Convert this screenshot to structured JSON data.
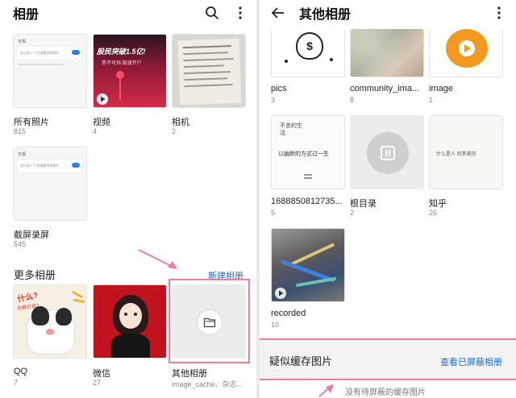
{
  "left": {
    "title": "相册",
    "albums": [
      {
        "name": "所有照片",
        "count": "815"
      },
      {
        "name": "视频",
        "count": "4"
      },
      {
        "name": "相机",
        "count": "2"
      },
      {
        "name": "截屏录屏",
        "count": "545"
      }
    ],
    "video_banner_top": "股民突破1.5亿!",
    "video_banner_bottom": "势不可挡 极速开户",
    "more_section": "更多相册",
    "new_album": "新建相册",
    "more_albums": [
      {
        "name": "QQ",
        "count": "7"
      },
      {
        "name": "微信",
        "count": "27"
      },
      {
        "name": "其他相册",
        "count": "image_cache、杂志..."
      }
    ],
    "cat_caption": "什么?",
    "cat_caption2": "你要打我?",
    "mini_ui_label": "日报",
    "mini_ui_text": "显示前 3 个月或更早的图片"
  },
  "right": {
    "title": "其他相册",
    "albums": [
      {
        "name": "pics",
        "count": "3"
      },
      {
        "name": "community_ima...",
        "count": "8"
      },
      {
        "name": "image",
        "count": "1"
      },
      {
        "name": "1688850812735...",
        "count": "5"
      },
      {
        "name": "根目录",
        "count": "2"
      },
      {
        "name": "知乎",
        "count": "26"
      },
      {
        "name": "recorded",
        "count": "10"
      }
    ],
    "doc_text_top": "不言的生活",
    "doc_text_mid": "以幽默的方式过一生",
    "zhihu_text": "什么是人 欣赏美你",
    "cache_title": "疑似缓存图片",
    "cache_link": "查看已屏蔽相册",
    "no_cache": "没有待屏蔽的缓存图片"
  },
  "colors": {
    "accent": "#1a6cd6",
    "highlight": "#ee7ba6",
    "video_bg": "#c8213a",
    "avatar_bg": "#c1121f",
    "image_orange": "#f29a1f"
  }
}
